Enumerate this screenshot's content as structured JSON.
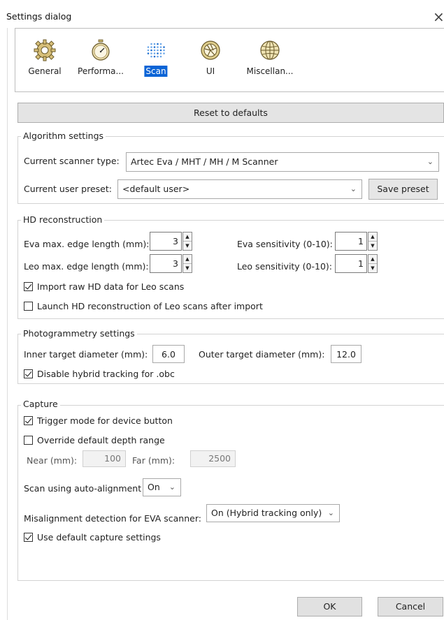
{
  "window": {
    "title": "Settings dialog",
    "close_glyph": "×"
  },
  "categories": [
    {
      "label": "General",
      "icon": "gear-icon",
      "selected": false
    },
    {
      "label": "Performa...",
      "icon": "stopwatch-icon",
      "selected": false
    },
    {
      "label": "Scan",
      "icon": "dot-grid-icon",
      "selected": true
    },
    {
      "label": "UI",
      "icon": "aperture-icon",
      "selected": false
    },
    {
      "label": "Miscellan...",
      "icon": "globe-icon",
      "selected": false
    }
  ],
  "reset_label": "Reset to defaults",
  "algorithm": {
    "title": "Algorithm settings",
    "scanner_label": "Current scanner type:",
    "scanner_value": "Artec Eva / MHT / MH / M Scanner",
    "preset_label": "Current user preset:",
    "preset_value": "<default user>",
    "save_preset_label": "Save preset"
  },
  "hd": {
    "title": "HD reconstruction",
    "eva_edge_label": "Eva max. edge length (mm):",
    "eva_edge_value": "3",
    "eva_sens_label": "Eva sensitivity (0-10):",
    "eva_sens_value": "1",
    "leo_edge_label": "Leo max. edge length (mm):",
    "leo_edge_value": "3",
    "leo_sens_label": "Leo sensitivity (0-10):",
    "leo_sens_value": "1",
    "import_raw_label": "Import raw HD data for Leo scans",
    "import_raw_checked": true,
    "launch_hd_label": "Launch HD reconstruction of Leo scans after import",
    "launch_hd_checked": false
  },
  "photo": {
    "title": "Photogrammetry settings",
    "inner_label": "Inner target diameter (mm):",
    "inner_value": "6.0",
    "outer_label": "Outer target diameter (mm):",
    "outer_value": "12.0",
    "disable_hybrid_label": "Disable hybrid tracking for .obc",
    "disable_hybrid_checked": true
  },
  "capture": {
    "title": "Capture",
    "trigger_label": "Trigger mode for device button",
    "trigger_checked": true,
    "override_label": "Override default depth range",
    "override_checked": false,
    "near_label": "Near (mm):",
    "near_value": "100",
    "far_label": "Far (mm):",
    "far_value": "2500",
    "autoalign_label": "Scan using auto-alignment",
    "autoalign_value": "On",
    "misalign_label": "Misalignment detection for EVA scanner:",
    "misalign_value": "On (Hybrid tracking only)",
    "default_capture_label": "Use default capture settings",
    "default_capture_checked": true
  },
  "footer": {
    "ok_label": "OK",
    "cancel_label": "Cancel"
  },
  "colors": {
    "accent": "#0a64d6",
    "button_bg": "#e1e1e1",
    "border": "#adadad"
  }
}
